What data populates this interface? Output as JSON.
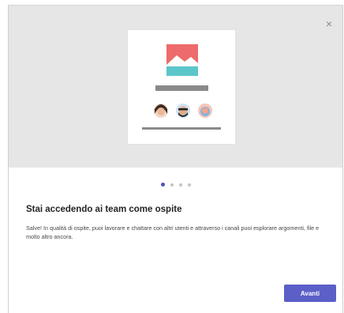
{
  "dialog": {
    "close_icon": "close-icon",
    "close_glyph": "×",
    "title": "Stai accedendo ai team come ospite",
    "body": "Salve! In qualità di ospite, puoi lavorare e chattare con altri utenti e attraverso i canali puoi esplorare argomenti, file e molto altro ancora.",
    "next_label": "Avanti",
    "pagination": {
      "total": 4,
      "active": 1
    }
  },
  "colors": {
    "accent": "#5b5fc7",
    "hero_bg": "#e6e6e6",
    "image_pink": "#ee6b6b",
    "image_teal": "#5bc6c9"
  }
}
